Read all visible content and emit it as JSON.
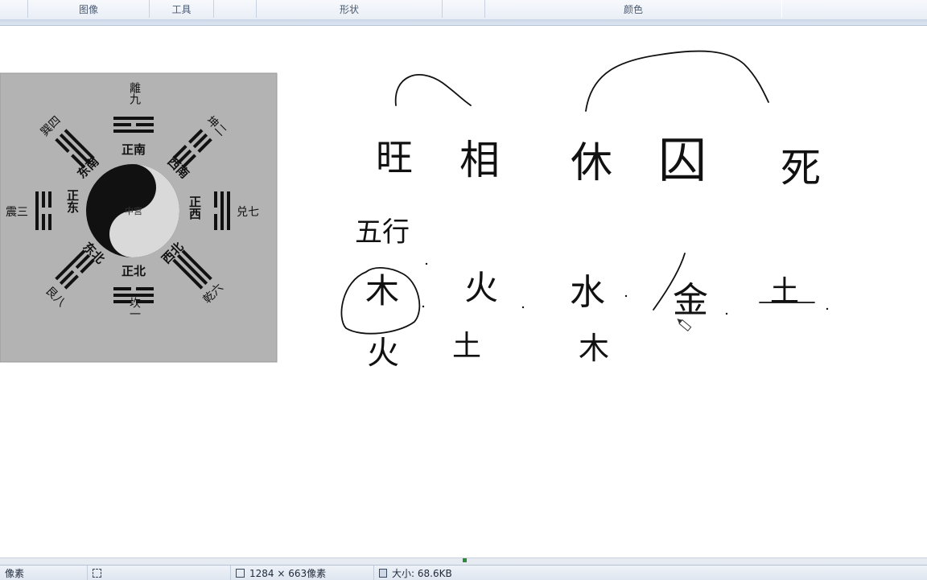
{
  "ribbon": {
    "groups": [
      "图像",
      "工具",
      "形状",
      "颜色"
    ]
  },
  "bagua": {
    "center": "中宫",
    "directions": {
      "s": "正南",
      "sw": "西南",
      "w": "正西",
      "nw": "西北",
      "n": "正北",
      "ne": "东北",
      "e": "正东",
      "se": "东南"
    },
    "trigrams": {
      "li": "離九",
      "kun": "坤二",
      "dui": "兑七",
      "qian": "乾六",
      "kan": "坎一",
      "gen": "艮八",
      "zhen": "震三",
      "xun": "巽四"
    }
  },
  "handwriting": {
    "row1": [
      "旺",
      "相",
      "休",
      "囚",
      "死"
    ],
    "row2_label": "五行",
    "row3": [
      "木",
      "火",
      "水",
      "金",
      "土"
    ],
    "row4": [
      "火",
      "土",
      "木"
    ]
  },
  "statusbar": {
    "left_text": "像素",
    "selection_icon": "selection-icon",
    "dimensions": "1284 × 663像素",
    "size": "大小: 68.6KB"
  },
  "colors": {
    "accent": "#2d8a3a",
    "bagua_bg": "#b3b3b3"
  }
}
